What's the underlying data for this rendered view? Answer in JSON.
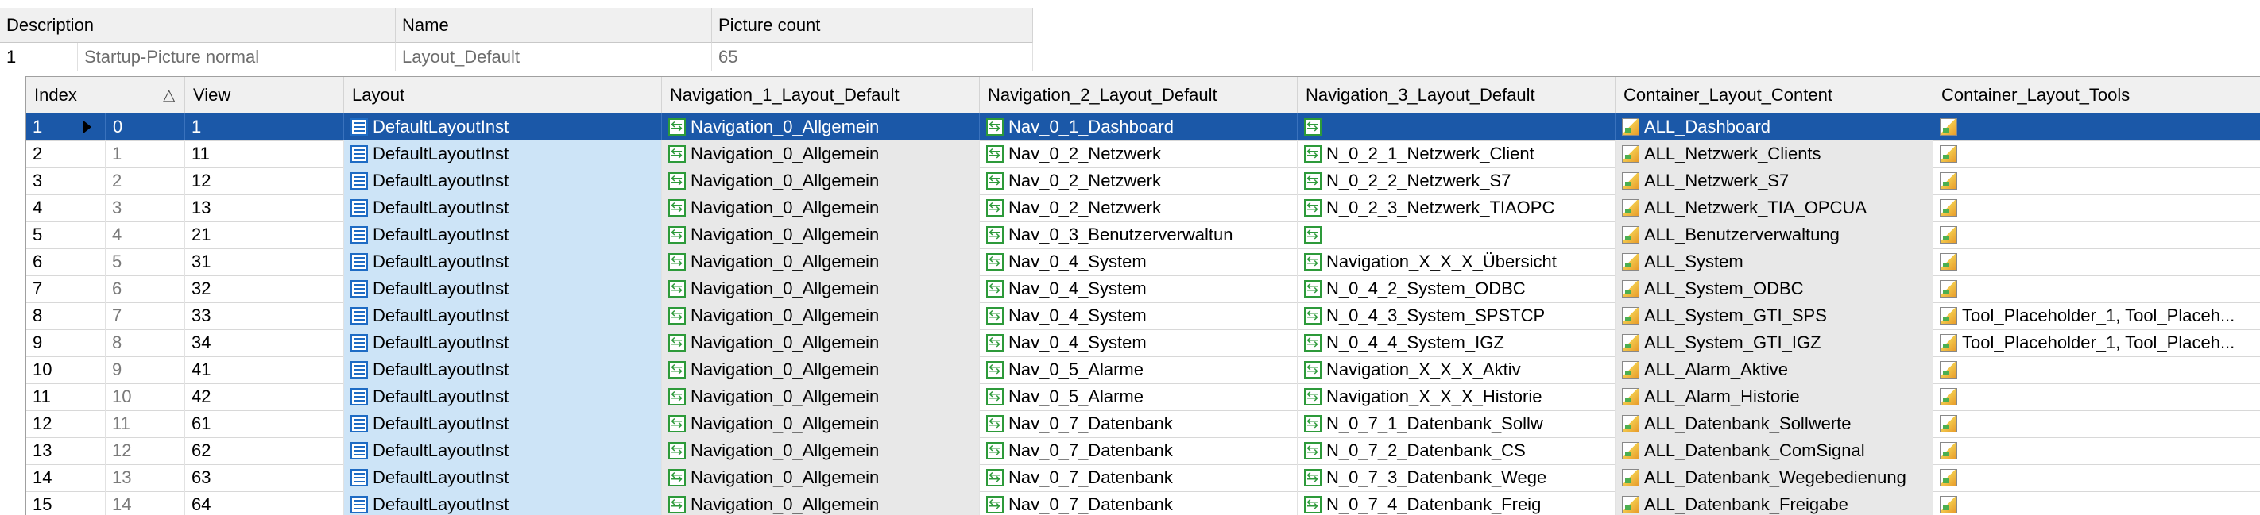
{
  "parent": {
    "columns": [
      "Description",
      "Name",
      "Picture count"
    ],
    "row": {
      "num": "1",
      "description": "Startup-Picture normal",
      "name": "Layout_Default",
      "picture_count": "65"
    }
  },
  "child": {
    "columns": [
      "Index",
      "View",
      "Layout",
      "Navigation_1_Layout_Default",
      "Navigation_2_Layout_Default",
      "Navigation_3_Layout_Default",
      "Container_Layout_Content",
      "Container_Layout_Tools"
    ],
    "sort_icon": "sort-ascending-icon",
    "rows": [
      {
        "num": "1",
        "index": "0",
        "view": "1",
        "layout": "DefaultLayoutInst",
        "nav1": "Navigation_0_Allgemein",
        "nav2": "Nav_0_1_Dashboard",
        "nav3": "",
        "content": "ALL_Dashboard",
        "tools": ""
      },
      {
        "num": "2",
        "index": "1",
        "view": "11",
        "layout": "DefaultLayoutInst",
        "nav1": "Navigation_0_Allgemein",
        "nav2": "Nav_0_2_Netzwerk",
        "nav3": "N_0_2_1_Netzwerk_Client",
        "content": "ALL_Netzwerk_Clients",
        "tools": ""
      },
      {
        "num": "3",
        "index": "2",
        "view": "12",
        "layout": "DefaultLayoutInst",
        "nav1": "Navigation_0_Allgemein",
        "nav2": "Nav_0_2_Netzwerk",
        "nav3": "N_0_2_2_Netzwerk_S7",
        "content": "ALL_Netzwerk_S7",
        "tools": ""
      },
      {
        "num": "4",
        "index": "3",
        "view": "13",
        "layout": "DefaultLayoutInst",
        "nav1": "Navigation_0_Allgemein",
        "nav2": "Nav_0_2_Netzwerk",
        "nav3": "N_0_2_3_Netzwerk_TIAOPC",
        "content": "ALL_Netzwerk_TIA_OPCUA",
        "tools": ""
      },
      {
        "num": "5",
        "index": "4",
        "view": "21",
        "layout": "DefaultLayoutInst",
        "nav1": "Navigation_0_Allgemein",
        "nav2": "Nav_0_3_Benutzerverwaltun",
        "nav3": "",
        "content": "ALL_Benutzerverwaltung",
        "tools": ""
      },
      {
        "num": "6",
        "index": "5",
        "view": "31",
        "layout": "DefaultLayoutInst",
        "nav1": "Navigation_0_Allgemein",
        "nav2": "Nav_0_4_System",
        "nav3": "Navigation_X_X_X_Übersicht",
        "content": "ALL_System",
        "tools": ""
      },
      {
        "num": "7",
        "index": "6",
        "view": "32",
        "layout": "DefaultLayoutInst",
        "nav1": "Navigation_0_Allgemein",
        "nav2": "Nav_0_4_System",
        "nav3": "N_0_4_2_System_ODBC",
        "content": "ALL_System_ODBC",
        "tools": ""
      },
      {
        "num": "8",
        "index": "7",
        "view": "33",
        "layout": "DefaultLayoutInst",
        "nav1": "Navigation_0_Allgemein",
        "nav2": "Nav_0_4_System",
        "nav3": "N_0_4_3_System_SPSTCP",
        "content": "ALL_System_GTI_SPS",
        "tools": "Tool_Placeholder_1, Tool_Placeh..."
      },
      {
        "num": "9",
        "index": "8",
        "view": "34",
        "layout": "DefaultLayoutInst",
        "nav1": "Navigation_0_Allgemein",
        "nav2": "Nav_0_4_System",
        "nav3": "N_0_4_4_System_IGZ",
        "content": "ALL_System_GTI_IGZ",
        "tools": "Tool_Placeholder_1, Tool_Placeh..."
      },
      {
        "num": "10",
        "index": "9",
        "view": "41",
        "layout": "DefaultLayoutInst",
        "nav1": "Navigation_0_Allgemein",
        "nav2": "Nav_0_5_Alarme",
        "nav3": "Navigation_X_X_X_Aktiv",
        "content": "ALL_Alarm_Aktive",
        "tools": ""
      },
      {
        "num": "11",
        "index": "10",
        "view": "42",
        "layout": "DefaultLayoutInst",
        "nav1": "Navigation_0_Allgemein",
        "nav2": "Nav_0_5_Alarme",
        "nav3": "Navigation_X_X_X_Historie",
        "content": "ALL_Alarm_Historie",
        "tools": ""
      },
      {
        "num": "12",
        "index": "11",
        "view": "61",
        "layout": "DefaultLayoutInst",
        "nav1": "Navigation_0_Allgemein",
        "nav2": "Nav_0_7_Datenbank",
        "nav3": "N_0_7_1_Datenbank_Sollw",
        "content": "ALL_Datenbank_Sollwerte",
        "tools": ""
      },
      {
        "num": "13",
        "index": "12",
        "view": "62",
        "layout": "DefaultLayoutInst",
        "nav1": "Navigation_0_Allgemein",
        "nav2": "Nav_0_7_Datenbank",
        "nav3": "N_0_7_2_Datenbank_CS",
        "content": "ALL_Datenbank_ComSignal",
        "tools": ""
      },
      {
        "num": "14",
        "index": "13",
        "view": "63",
        "layout": "DefaultLayoutInst",
        "nav1": "Navigation_0_Allgemein",
        "nav2": "Nav_0_7_Datenbank",
        "nav3": "N_0_7_3_Datenbank_Wege",
        "content": "ALL_Datenbank_Wegebedienung",
        "tools": ""
      },
      {
        "num": "15",
        "index": "14",
        "view": "64",
        "layout": "DefaultLayoutInst",
        "nav1": "Navigation_0_Allgemein",
        "nav2": "Nav_0_7_Datenbank",
        "nav3": "N_0_7_4_Datenbank_Freig",
        "content": "ALL_Datenbank_Freigabe",
        "tools": ""
      }
    ]
  }
}
